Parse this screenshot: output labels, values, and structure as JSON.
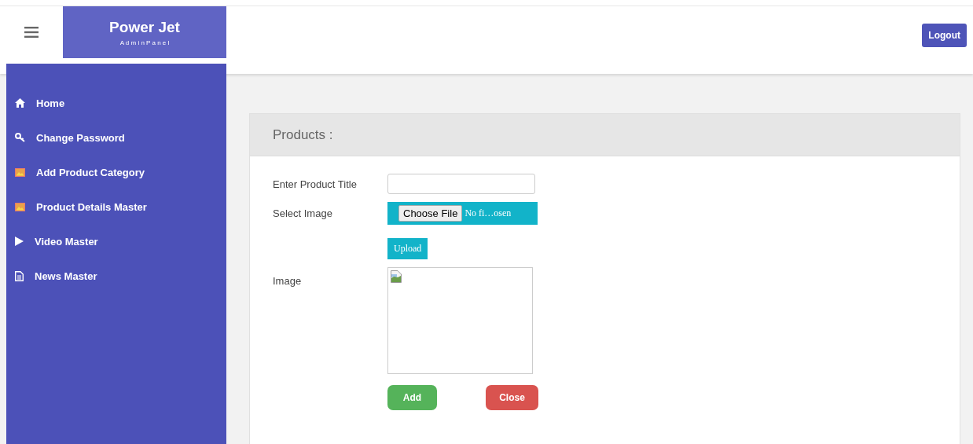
{
  "brand": {
    "title": "Power Jet",
    "subtitle": "A d m i n P a n e l"
  },
  "header": {
    "logout": "Logout"
  },
  "sidebar": {
    "items": [
      {
        "label": "Home",
        "kind": "home"
      },
      {
        "label": "Change Password",
        "kind": "key"
      },
      {
        "label": "Add Product Category",
        "kind": "image"
      },
      {
        "label": "Product Details Master",
        "kind": "image"
      },
      {
        "label": "Video Master",
        "kind": "play"
      },
      {
        "label": "News Master",
        "kind": "file"
      }
    ]
  },
  "panel": {
    "title": "Products :",
    "title_label": "Enter Product Title",
    "image_label": "Select Image",
    "choose_file": "Choose File",
    "file_status": "No fi…osen",
    "upload": "Upload",
    "preview_label": "Image",
    "add": "Add",
    "close": "Close"
  }
}
